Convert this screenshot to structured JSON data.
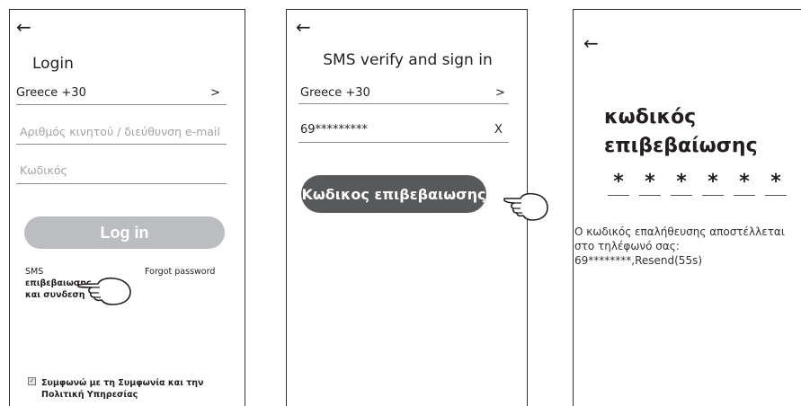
{
  "screen_login": {
    "back_icon": "arrow-left-icon",
    "title": "Login",
    "country": "Greece +30",
    "country_chevron": ">",
    "phone_placeholder": "Αριθμός κινητού / διεύθυνση e-mail",
    "password_placeholder": "Κωδικός",
    "login_button": "Log in",
    "sms_label": "SMS",
    "sms_line2": "επιβεβαιωσης",
    "sms_line3": "και συνδεση",
    "forgot_password": "Forgot password",
    "agree_text": "Συμφωνώ με τη Συμφωνία και την Πολιτική Υπηρεσίας",
    "hand_icon": "pointing-hand-icon"
  },
  "screen_sms": {
    "back_icon": "arrow-left-icon",
    "title": "SMS verify and sign in",
    "country": "Greece +30",
    "country_chevron": ">",
    "phone_value": "69*********",
    "clear_label": "X",
    "verify_button": "Κωδικος επιβεβαιωσης",
    "hand_icon": "pointing-hand-icon"
  },
  "screen_code": {
    "back_icon": "arrow-left-icon",
    "title": "κωδικός επιβεβαίωσης",
    "code_digits": [
      "*",
      "*",
      "*",
      "*",
      "*",
      "*"
    ],
    "info_line1": "Ο κωδικός επαλήθευσης αποστέλλεται",
    "info_line2": "στο τηλέφωνό σας:",
    "info_line3": "69********,Resend(55s)"
  }
}
